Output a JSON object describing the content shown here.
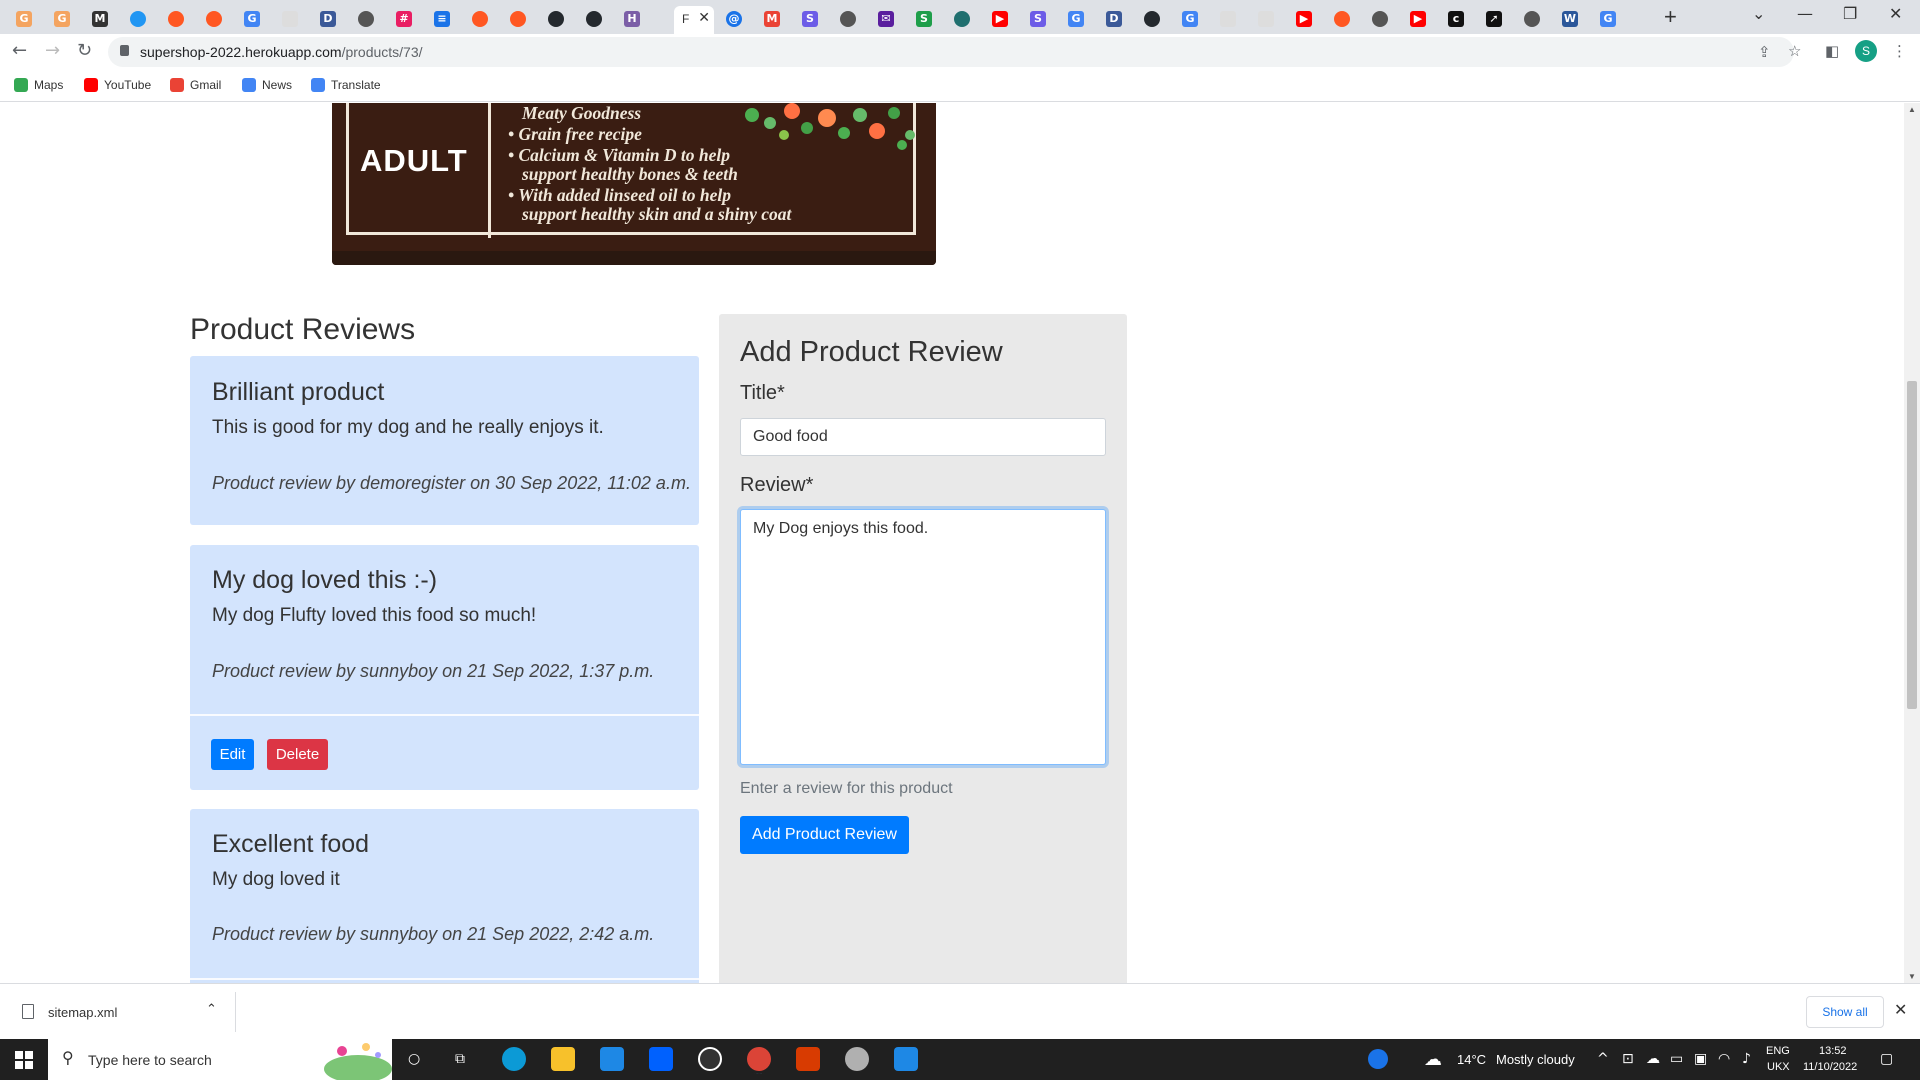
{
  "browser": {
    "url_host": "supershop-2022.herokuapp.com",
    "url_path": "/products/73/",
    "active_tab_label": "F",
    "profile_initial": "S"
  },
  "bookmarks": [
    {
      "label": "Maps",
      "color": "#34a853"
    },
    {
      "label": "YouTube",
      "color": "#ff0000"
    },
    {
      "label": "Gmail",
      "color": "#ea4335"
    },
    {
      "label": "News",
      "color": "#4285f4"
    },
    {
      "label": "Translate",
      "color": "#4285f4"
    }
  ],
  "product_image": {
    "badge": "ADULT",
    "bullets": [
      "Meaty Goodness",
      "• Grain free recipe",
      "• Calcium & Vitamin D to help",
      "support healthy bones & teeth",
      "• With added linseed oil to help",
      "support healthy skin and a shiny coat"
    ]
  },
  "reviews": {
    "heading": "Product Reviews",
    "items": [
      {
        "title": "Brilliant product",
        "body": "This is good for my dog and he really enjoys it.",
        "meta": "Product review by demoregister on 30 Sep 2022, 11:02 a.m."
      },
      {
        "title": "My dog loved this :-)",
        "body": "My dog Flufty loved this food so much!",
        "meta": "Product review by sunnyboy on 21 Sep 2022, 1:37 p.m.",
        "edit_label": "Edit",
        "delete_label": "Delete"
      },
      {
        "title": "Excellent food",
        "body": "My dog loved it",
        "meta": "Product review by sunnyboy on 21 Sep 2022, 2:42 a.m."
      }
    ]
  },
  "add_review": {
    "heading": "Add Product Review",
    "title_label": "Title*",
    "title_value": "Good food",
    "review_label": "Review*",
    "review_value": "My Dog enjoys this food.",
    "help_text": "Enter a review for this product",
    "submit_label": "Add Product Review"
  },
  "downloads": {
    "file_name": "sitemap.xml",
    "show_all_label": "Show all"
  },
  "taskbar": {
    "search_placeholder": "Type here to search",
    "weather_temp": "14°C",
    "weather_text": "Mostly cloudy",
    "lang_top": "ENG",
    "lang_bottom": "UKX",
    "time": "13:52",
    "date": "11/10/2022"
  },
  "colors": {
    "review_card_bg": "#d3e4fd",
    "primary": "#007bff",
    "danger": "#dc3545",
    "panel_bg": "#e9e9e9"
  }
}
